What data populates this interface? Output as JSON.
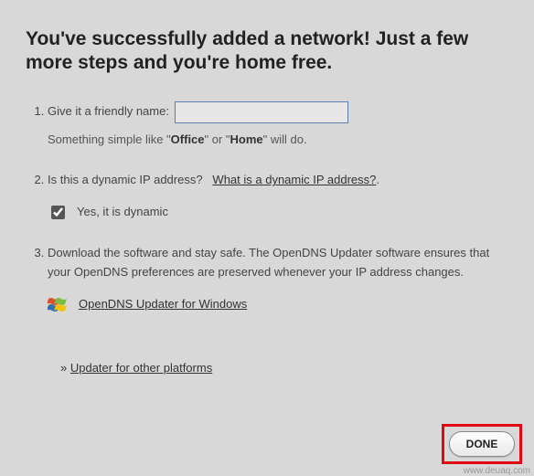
{
  "heading": "You've successfully added a network! Just a few more steps and you're home free.",
  "step1": {
    "label": "Give it a friendly name:",
    "input_value": "",
    "hint_prefix": "Something simple like \"",
    "hint_ex1": "Office",
    "hint_mid": "\" or \"",
    "hint_ex2": "Home",
    "hint_suffix": "\" will do."
  },
  "step2": {
    "question": "Is this a dynamic IP address?",
    "help_link": "What is a dynamic IP address?",
    "help_tail": ".",
    "checkbox_checked": true,
    "checkbox_label": "Yes, it is dynamic"
  },
  "step3": {
    "body": "Download the software and stay safe. The OpenDNS Updater software ensures that your OpenDNS preferences are preserved whenever your IP address changes.",
    "dl_link": "OpenDNS Updater for Windows"
  },
  "other_platforms_prefix": "» ",
  "other_platforms_link": "Updater for other platforms",
  "done_label": "DONE",
  "watermark": "www.deuaq.com"
}
